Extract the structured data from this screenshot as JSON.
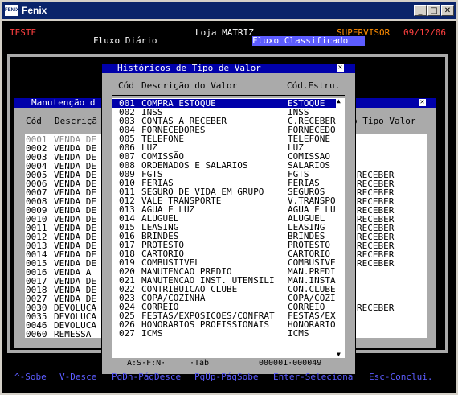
{
  "window": {
    "title": "Fenix",
    "icon_label": "FENIX"
  },
  "header": {
    "company": "TESTE",
    "store": "Loja MATRIZ",
    "user": "SUPERVISOR",
    "date": "09/12/06",
    "screen": "Fluxo Diário",
    "mode": "Fluxo Classificado"
  },
  "back_panel": {
    "title": "Manutenção d",
    "col_code": "Cód",
    "col_desc": "Descriçã",
    "col_type": "o Tipo Valor",
    "rows": [
      {
        "code": "0001",
        "desc": "VENDA DE",
        "type": ""
      },
      {
        "code": "0002",
        "desc": "VENDA DE",
        "type": ""
      },
      {
        "code": "0003",
        "desc": "VENDA DE",
        "type": ""
      },
      {
        "code": "0004",
        "desc": "VENDA DE",
        "type": ""
      },
      {
        "code": "0005",
        "desc": "VENDA DE",
        "type": "RECEBER"
      },
      {
        "code": "0006",
        "desc": "VENDA DE",
        "type": "RECEBER"
      },
      {
        "code": "0007",
        "desc": "VENDA DE",
        "type": "RECEBER"
      },
      {
        "code": "0008",
        "desc": "VENDA DE",
        "type": "RECEBER"
      },
      {
        "code": "0009",
        "desc": "VENDA DE",
        "type": "RECEBER"
      },
      {
        "code": "0010",
        "desc": "VENDA DE",
        "type": "RECEBER"
      },
      {
        "code": "0011",
        "desc": "VENDA DE",
        "type": "RECEBER"
      },
      {
        "code": "0012",
        "desc": "VENDA DE",
        "type": "RECEBER"
      },
      {
        "code": "0013",
        "desc": "VENDA DE",
        "type": "RECEBER"
      },
      {
        "code": "0014",
        "desc": "VENDA DE",
        "type": "RECEBER"
      },
      {
        "code": "0015",
        "desc": "VENDA DE",
        "type": "RECEBER"
      },
      {
        "code": "0016",
        "desc": "VENDA A",
        "type": ""
      },
      {
        "code": "0017",
        "desc": "VENDA DE",
        "type": ""
      },
      {
        "code": "0018",
        "desc": "VENDA DE",
        "type": ""
      },
      {
        "code": "0027",
        "desc": "VENDA DE",
        "type": ""
      },
      {
        "code": "0030",
        "desc": "DEVOLUCA",
        "type": "RECEBER"
      },
      {
        "code": "0035",
        "desc": "DEVOLUCA",
        "type": ""
      },
      {
        "code": "0046",
        "desc": "DEVOLUCA",
        "type": ""
      },
      {
        "code": "0060",
        "desc": "REMESSA",
        "type": ""
      }
    ]
  },
  "popup": {
    "title": "Históricos de Tipo de Valor",
    "col_code": "Cód",
    "col_desc": "Descrição do Valor",
    "col_struct": "Cód.Estru.",
    "rows": [
      {
        "code": "001",
        "desc": "COMPRA ESTOQUE",
        "struct": "ESTOQUE"
      },
      {
        "code": "002",
        "desc": "INSS",
        "struct": "INSS"
      },
      {
        "code": "003",
        "desc": "CONTAS A RECEBER",
        "struct": "C.RECEBER"
      },
      {
        "code": "004",
        "desc": "FORNECEDORES",
        "struct": "FORNECEDOR"
      },
      {
        "code": "005",
        "desc": "TELEFONE",
        "struct": "TELEFONE"
      },
      {
        "code": "006",
        "desc": "LUZ",
        "struct": "LUZ"
      },
      {
        "code": "007",
        "desc": "COMISSÃO",
        "struct": "COMISSAO"
      },
      {
        "code": "008",
        "desc": "ORDENADOS E SALARIOS",
        "struct": "SALARIOS"
      },
      {
        "code": "009",
        "desc": "FGTS",
        "struct": "FGTS"
      },
      {
        "code": "010",
        "desc": "FERIAS",
        "struct": "FERIAS"
      },
      {
        "code": "011",
        "desc": "SEGURO DE VIDA EM GRUPO",
        "struct": "SEGUROS"
      },
      {
        "code": "012",
        "desc": "VALE TRANSPORTE",
        "struct": "V.TRANSPOR"
      },
      {
        "code": "013",
        "desc": "AGUA E LUZ",
        "struct": "AGUA E LUZ"
      },
      {
        "code": "014",
        "desc": "ALUGUEL",
        "struct": "ALUGUEL"
      },
      {
        "code": "015",
        "desc": "LEASING",
        "struct": "LEASING"
      },
      {
        "code": "016",
        "desc": "BRINDES",
        "struct": "BRINDES"
      },
      {
        "code": "017",
        "desc": "PROTESTO",
        "struct": "PROTESTO"
      },
      {
        "code": "018",
        "desc": "CARTORIO",
        "struct": "CARTORIO"
      },
      {
        "code": "019",
        "desc": "COMBUSTIVEL",
        "struct": "COMBUSIVEL"
      },
      {
        "code": "020",
        "desc": "MANUTENCAO PREDIO",
        "struct": "MAN.PREDIO"
      },
      {
        "code": "021",
        "desc": "MANUTENCAO INST. UTENSILI",
        "struct": "MAN.INSTAL"
      },
      {
        "code": "022",
        "desc": "CONTRIBUICAO CLUBE",
        "struct": "CON.CLUBE"
      },
      {
        "code": "023",
        "desc": "COPA/COZINHA",
        "struct": "COPA/COZIN"
      },
      {
        "code": "024",
        "desc": "CORREIO",
        "struct": "CORREIO"
      },
      {
        "code": "025",
        "desc": "FESTAS/EXPOSICOES/CONFRAT",
        "struct": "FESTAS/EXP"
      },
      {
        "code": "026",
        "desc": "HONORARIOS PROFISSIONAIS",
        "struct": "HONORARIOS"
      },
      {
        "code": "027",
        "desc": "ICMS",
        "struct": "ICMS"
      }
    ],
    "status_mode": "A:S·F:N·",
    "status_tab": "·Tab",
    "status_counter": "000001·000049"
  },
  "keys": [
    "^-Sobe",
    "V-Desce",
    "PgDn-PágDesce",
    "PgUp-PágSobe",
    "Enter-Seleciona",
    "Esc-Conclui."
  ],
  "colors": {
    "title_blue": "#0a246a",
    "dos_blue": "#0000aa",
    "header_red": "#ff4040",
    "supervisor_orange": "#ff8c00",
    "key_help": "#5c5cff"
  }
}
